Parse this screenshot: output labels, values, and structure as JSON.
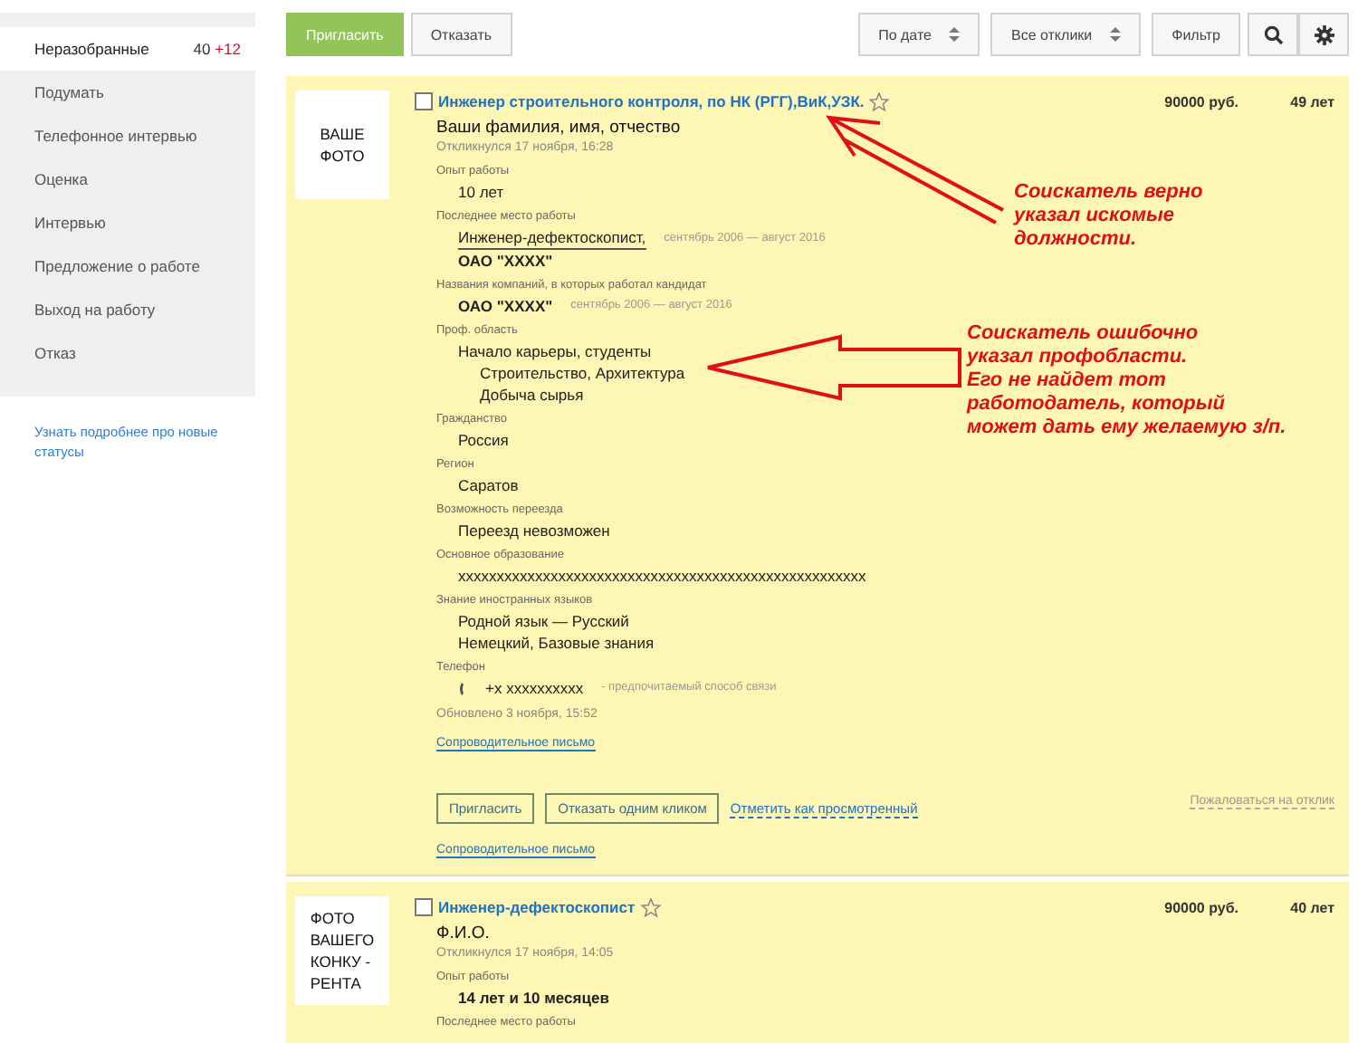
{
  "sidebar": {
    "items": [
      {
        "label": "Неразобранные",
        "count": "40",
        "new_count": "+12",
        "selected": true
      },
      {
        "label": "Подумать",
        "selected": false
      },
      {
        "label": "Телефонное интервью",
        "selected": false
      },
      {
        "label": "Оценка",
        "selected": false
      },
      {
        "label": "Интервью",
        "selected": false
      },
      {
        "label": "Предложение о работе",
        "selected": false
      },
      {
        "label": "Выход на работу",
        "selected": false
      },
      {
        "label": "Отказ",
        "selected": false
      }
    ],
    "link": "Узнать подробнее про новые статусы"
  },
  "toolbar": {
    "left": [
      {
        "kind": "primary",
        "label": "Пригласить"
      },
      {
        "kind": "plain",
        "label": "Отказать"
      }
    ],
    "right": [
      {
        "kind": "select",
        "label": "По дате"
      },
      {
        "kind": "select",
        "label": "Все отклики"
      },
      {
        "kind": "plain",
        "label": "Фильтр"
      },
      {
        "kind": "search"
      },
      {
        "kind": "settings"
      }
    ]
  },
  "responses": [
    {
      "photo": [
        "ВАШЕ",
        "ФОТО"
      ],
      "selected": false,
      "starred": false,
      "title": "Инженер строительного контроля, по НК (РГГ),ВиК,УЗК.",
      "salary": "90000 руб.",
      "age": "49 лет",
      "name": "Ваши фамилия, имя, отчество",
      "responded": "Откликнулся 17 ноября, 16:28",
      "fields": [
        {
          "label": "Опыт работы",
          "values": [
            {
              "kind": "plain",
              "text": "10 лет"
            }
          ]
        },
        {
          "label": "Последнее место работы",
          "values": [
            {
              "kind": "position",
              "text": "Инженер-дефектоскопист,",
              "note": "сентябрь 2006 — август 2016"
            },
            {
              "kind": "bold",
              "text": "ОАО \"XXXX\""
            }
          ]
        },
        {
          "label": "Названия компаний, в которых работал кандидат",
          "values": [
            {
              "kind": "bold",
              "text": "ОАО \"XXXX\"",
              "note": "сентябрь 2006 — август 2016"
            }
          ]
        },
        {
          "label": "Проф. область",
          "tree": [
            {
              "text": "Начало карьеры, студенты",
              "children": [
                {
                  "text": "Строительство, Архитектура"
                },
                {
                  "text": "Добыча сырья"
                }
              ]
            }
          ]
        },
        {
          "label": "Гражданство",
          "values": [
            {
              "kind": "plain",
              "text": "Россия"
            }
          ]
        },
        {
          "label": "Регион",
          "values": [
            {
              "kind": "plain",
              "text": "Саратов"
            }
          ]
        },
        {
          "label": "Возможность переезда",
          "values": [
            {
              "kind": "plain",
              "text": "Переезд невозможен"
            }
          ]
        },
        {
          "label": "Основное образование",
          "values": [
            {
              "kind": "plain",
              "text": "xxxxxxxxxxxxxxxxxxxxxxxxxxxxxxxxxxxxxxxxxxxxxxxxxxxxx"
            }
          ]
        },
        {
          "label": "Знание иностранных языков",
          "values": [
            {
              "kind": "plain",
              "text": "Родной язык — Русский"
            },
            {
              "kind": "plain",
              "text": "Немецкий, Базовые знания"
            }
          ]
        },
        {
          "label": "Телефон",
          "values": [
            {
              "kind": "phone",
              "text": "+x xxxxxxxxxx",
              "note": "- предпочитаемый способ связи"
            }
          ]
        }
      ],
      "updated": "Обновлено 3 ноября, 15:52",
      "cover_link": "Сопроводительное письмо",
      "actions": [
        {
          "kind": "button",
          "label": "Пригласить"
        },
        {
          "kind": "button",
          "label": "Отказать одним кликом"
        },
        {
          "kind": "link",
          "label": "Отметить как просмотренный"
        },
        {
          "kind": "complaint",
          "label": "Пожаловаться на отклик"
        }
      ],
      "bottom_link": "Сопроводительное письмо",
      "annotations": [
        {
          "kind": "line-arrow",
          "lines": [
            "Соискатель верно",
            "указал искомые",
            "должности."
          ]
        },
        {
          "kind": "block-arrow",
          "lines": [
            "Соискатель ошибочно",
            "указал профобласти.",
            "Его не найдет тот",
            "работодатель, который",
            "может дать ему желаемую з/п."
          ]
        }
      ]
    },
    {
      "photo": [
        "ФОТО",
        "ВАШЕГО",
        "КОНКУ -",
        "РЕНТА"
      ],
      "selected": false,
      "starred": false,
      "title": "Инженер-дефектоскопист",
      "salary": "90000 руб.",
      "age": "40 лет",
      "name": "Ф.И.О.",
      "responded": "Откликнулся 17 ноября, 14:05",
      "fields": [
        {
          "label": "Опыт работы",
          "values": [
            {
              "kind": "bold",
              "text": "14 лет и 10 месяцев"
            }
          ]
        },
        {
          "label": "Последнее место работы"
        }
      ]
    }
  ]
}
